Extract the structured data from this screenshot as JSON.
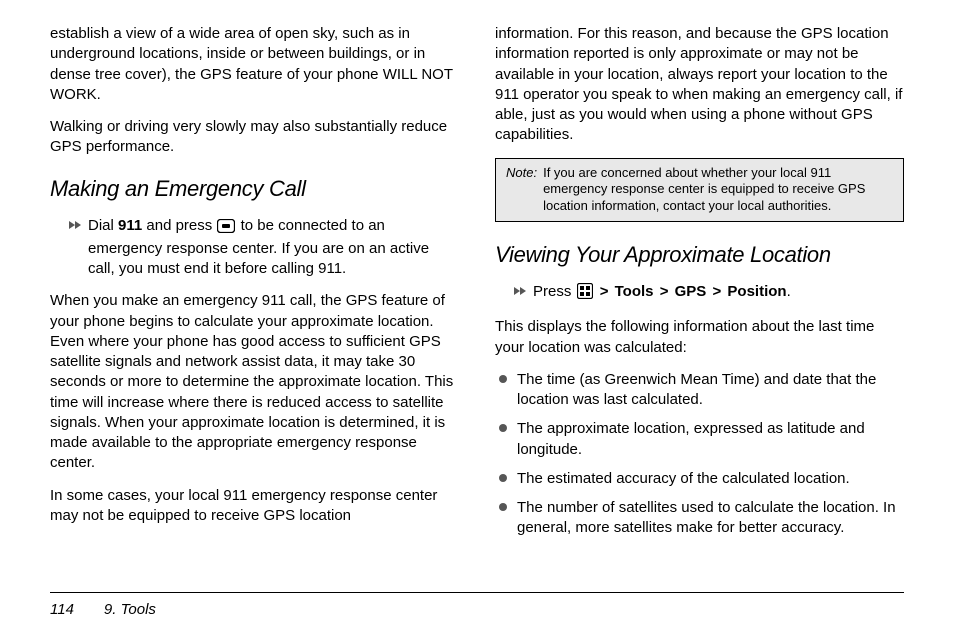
{
  "col1": {
    "p1": "establish a view of a wide area of open sky, such as in underground locations, inside or between buildings, or in dense tree cover), the GPS feature of your phone WILL NOT WORK.",
    "p2": "Walking or driving very slowly may also substantially reduce GPS performance.",
    "h1": "Making an Emergency Call",
    "step1_a": "Dial ",
    "step1_b": "911",
    "step1_c": " and press ",
    "step1_d": " to be connected to an emergency response center. If you are on an active call, you must end it before calling 911.",
    "p3": "When you make an emergency 911 call, the GPS feature of your phone begins to calculate your approximate location. Even where your phone has good access to sufficient GPS satellite signals and network assist data, it may take 30 seconds or more to determine the approximate location. This time will increase where there is reduced access to satellite signals. When your approximate location is determined, it is made available to the appropriate emergency response center.",
    "p4": "In some cases, your local 911 emergency response center may not be equipped to receive GPS location"
  },
  "col2": {
    "p1": "information. For this reason, and because the GPS location information reported is only approximate or may not be available in your location, always report your location to the 911 operator you speak to when making an emergency call, if able, just as you would when using a phone without GPS capabilities.",
    "note_label": "Note:",
    "note_text": "If you are concerned about whether your local 911 emergency response center is equipped to receive GPS location information, contact your local authorities.",
    "h1": "Viewing Your Approximate Location",
    "step1_a": "Press ",
    "step1_b": "Tools",
    "step1_c": "GPS",
    "step1_d": "Position",
    "step1_e": ".",
    "p2": "This displays the following information about the last time your location was calculated:",
    "bullets": [
      "The time (as Greenwich Mean Time) and date that the location was last calculated.",
      "The approximate location, expressed as latitude and longitude.",
      "The estimated accuracy of the calculated location.",
      "The number of satellites used to calculate the location. In general, more satellites make for better accuracy."
    ]
  },
  "footer": {
    "page": "114",
    "section": "9. Tools"
  },
  "sep": ">"
}
